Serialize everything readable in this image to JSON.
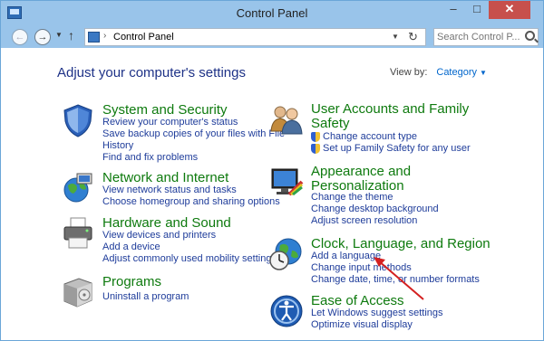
{
  "window": {
    "title": "Control Panel"
  },
  "address": {
    "path": "Control Panel",
    "search_placeholder": "Search Control P..."
  },
  "heading": "Adjust your computer's settings",
  "viewby": {
    "label": "View by:",
    "value": "Category"
  },
  "categories": [
    {
      "title": "System and Security",
      "icon": "shield-icon",
      "links": [
        "Review your computer's status",
        "Save backup copies of your files with File",
        "History",
        "Find and fix problems"
      ]
    },
    {
      "title": "Network and Internet",
      "icon": "network-globe-icon",
      "links": [
        "View network status and tasks",
        "Choose homegroup and sharing options"
      ]
    },
    {
      "title": "Hardware and Sound",
      "icon": "printer-icon",
      "links": [
        "View devices and printers",
        "Add a device",
        "Adjust commonly used mobility settings"
      ]
    },
    {
      "title": "Programs",
      "icon": "programs-box-icon",
      "links": [
        "Uninstall a program"
      ]
    },
    {
      "title_line1": "User Accounts and Family",
      "title_line2": "Safety",
      "icon": "users-icon",
      "links": [
        "Change account type",
        "Set up Family Safety for any user"
      ]
    },
    {
      "title_line1": "Appearance and",
      "title_line2": "Personalization",
      "icon": "monitor-paint-icon",
      "links": [
        "Change the theme",
        "Change desktop background",
        "Adjust screen resolution"
      ]
    },
    {
      "title": "Clock, Language, and Region",
      "icon": "clock-globe-icon",
      "links": [
        "Add a language",
        "Change input methods",
        "Change date, time, or number formats"
      ]
    },
    {
      "title": "Ease of Access",
      "icon": "ease-of-access-icon",
      "links": [
        "Let Windows suggest settings",
        "Optimize visual display"
      ]
    }
  ],
  "colors": {
    "category_title": "#0e7a0e",
    "link": "#1e3c9a",
    "heading": "#1e3287",
    "annotation_arrow": "#d42020"
  }
}
